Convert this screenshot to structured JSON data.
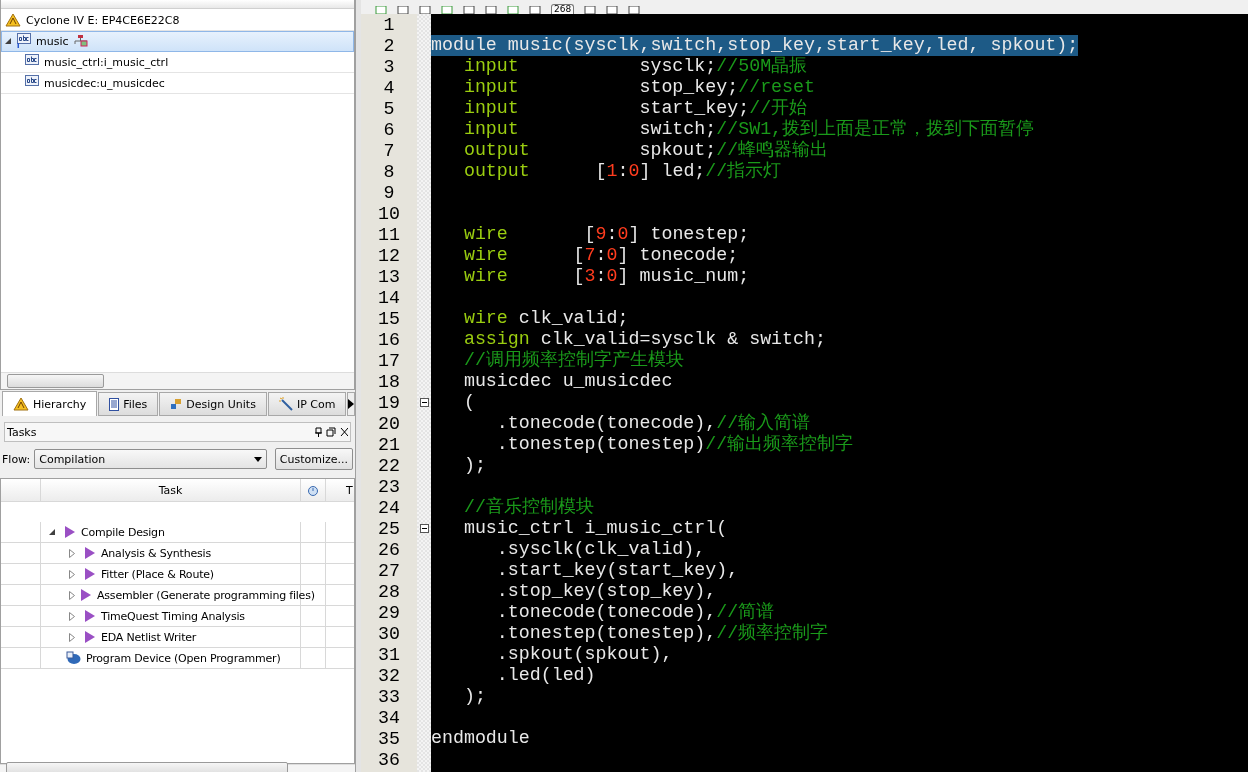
{
  "hierarchy": {
    "tree": [
      {
        "label": "Cyclone IV E: EP4CE6E22C8",
        "kind": "device",
        "selected": false
      },
      {
        "label": "music",
        "kind": "entity",
        "selected": true,
        "expanded": true,
        "children": [
          {
            "label": "music_ctrl:i_music_ctrl",
            "kind": "instance",
            "selected": false
          },
          {
            "label": "musicdec:u_musicdec",
            "kind": "instance",
            "selected": false
          }
        ]
      }
    ]
  },
  "tabs": [
    {
      "label": "Hierarchy",
      "kind": "hierarchy",
      "selected": true
    },
    {
      "label": "Files",
      "kind": "files",
      "selected": false
    },
    {
      "label": "Design Units",
      "kind": "units",
      "selected": false
    },
    {
      "label": "IP Com",
      "kind": "ip",
      "selected": false
    }
  ],
  "tasks": {
    "title": "Tasks",
    "flow_label": "Flow:",
    "flow_value": "Compilation",
    "customize": "Customize...",
    "columns": [
      "Task",
      "T"
    ],
    "rows": [
      {
        "label": "Compile Design",
        "kind": "compile",
        "expanded": true,
        "children": [
          {
            "label": "Analysis & Synthesis",
            "kind": "compile",
            "expanded": false
          },
          {
            "label": "Fitter (Place & Route)",
            "kind": "compile",
            "expanded": false
          },
          {
            "label": "Assembler (Generate programming files)",
            "kind": "compile",
            "expanded": false
          },
          {
            "label": "TimeQuest Timing Analysis",
            "kind": "compile",
            "expanded": false
          },
          {
            "label": "EDA Netlist Writer",
            "kind": "compile",
            "expanded": false
          }
        ]
      },
      {
        "label": "Program Device (Open Programmer)",
        "kind": "program"
      }
    ]
  },
  "toolbar": {
    "counter": "268"
  },
  "editor": {
    "lines": [
      {
        "number": "1"
      },
      {
        "number": "2",
        "selected": true,
        "segments": [
          {
            "kind": "text",
            "text": "module music(sysclk,switch,stop_key,start_key,led, spkout);"
          }
        ]
      },
      {
        "number": "3",
        "selected": false,
        "segments": [
          {
            "kind": "kw",
            "text": "   input"
          },
          {
            "kind": "text",
            "text": "           sysclk;"
          },
          {
            "kind": "comment",
            "text": "//50M晶振"
          }
        ]
      },
      {
        "number": "4",
        "selected": false,
        "segments": [
          {
            "kind": "kw",
            "text": "   input"
          },
          {
            "kind": "text",
            "text": "           stop_key;"
          },
          {
            "kind": "comment",
            "text": "//reset"
          }
        ]
      },
      {
        "number": "5",
        "selected": false,
        "segments": [
          {
            "kind": "kw",
            "text": "   input"
          },
          {
            "kind": "text",
            "text": "           start_key;"
          },
          {
            "kind": "comment",
            "text": "//开始"
          }
        ]
      },
      {
        "number": "6",
        "selected": false,
        "segments": [
          {
            "kind": "kw",
            "text": "   input"
          },
          {
            "kind": "text",
            "text": "           switch;"
          },
          {
            "kind": "comment",
            "text": "//SW1,拨到上面是正常，拨到下面暂停"
          }
        ]
      },
      {
        "number": "7",
        "selected": false,
        "segments": [
          {
            "kind": "kw",
            "text": "   output"
          },
          {
            "kind": "text",
            "text": "          spkout;"
          },
          {
            "kind": "comment",
            "text": "//蜂鸣器输出"
          }
        ]
      },
      {
        "number": "8",
        "selected": false,
        "segments": [
          {
            "kind": "kw",
            "text": "   output"
          },
          {
            "kind": "text",
            "text": "      ["
          },
          {
            "kind": "num",
            "text": "1"
          },
          {
            "kind": "text",
            "text": ":"
          },
          {
            "kind": "num",
            "text": "0"
          },
          {
            "kind": "text",
            "text": "] led;"
          },
          {
            "kind": "comment",
            "text": "//指示灯"
          }
        ]
      },
      {
        "number": "9"
      },
      {
        "number": "10"
      },
      {
        "number": "11",
        "selected": false,
        "segments": [
          {
            "kind": "kw",
            "text": "   wire"
          },
          {
            "kind": "text",
            "text": "       ["
          },
          {
            "kind": "num",
            "text": "9"
          },
          {
            "kind": "text",
            "text": ":"
          },
          {
            "kind": "num",
            "text": "0"
          },
          {
            "kind": "text",
            "text": "] tonestep;"
          }
        ]
      },
      {
        "number": "12",
        "selected": false,
        "segments": [
          {
            "kind": "kw",
            "text": "   wire"
          },
          {
            "kind": "text",
            "text": "      ["
          },
          {
            "kind": "num",
            "text": "7"
          },
          {
            "kind": "text",
            "text": ":"
          },
          {
            "kind": "num",
            "text": "0"
          },
          {
            "kind": "text",
            "text": "] tonecode;"
          }
        ]
      },
      {
        "number": "13",
        "selected": false,
        "segments": [
          {
            "kind": "kw",
            "text": "   wire"
          },
          {
            "kind": "text",
            "text": "      ["
          },
          {
            "kind": "num",
            "text": "3"
          },
          {
            "kind": "text",
            "text": ":"
          },
          {
            "kind": "num",
            "text": "0"
          },
          {
            "kind": "text",
            "text": "] music_num;"
          }
        ]
      },
      {
        "number": "14"
      },
      {
        "number": "15",
        "selected": false,
        "segments": [
          {
            "kind": "kw",
            "text": "   wire"
          },
          {
            "kind": "text",
            "text": " clk_valid;"
          }
        ]
      },
      {
        "number": "16",
        "selected": false,
        "segments": [
          {
            "kind": "kw",
            "text": "   assign"
          },
          {
            "kind": "text",
            "text": " clk_valid=sysclk & switch;"
          }
        ]
      },
      {
        "number": "17",
        "selected": false,
        "segments": [
          {
            "kind": "comment",
            "text": "   //调用频率控制字产生模块"
          }
        ]
      },
      {
        "number": "18",
        "selected": false,
        "segments": [
          {
            "kind": "text",
            "text": "   musicdec u_musicdec"
          }
        ]
      },
      {
        "number": "19",
        "selected": false,
        "fold": true,
        "segments": [
          {
            "kind": "text",
            "text": "   ("
          }
        ]
      },
      {
        "number": "20",
        "selected": false,
        "segments": [
          {
            "kind": "text",
            "text": "      .tonecode(tonecode),"
          },
          {
            "kind": "comment",
            "text": "//输入简谱"
          }
        ]
      },
      {
        "number": "21",
        "selected": false,
        "segments": [
          {
            "kind": "text",
            "text": "      .tonestep(tonestep)"
          },
          {
            "kind": "comment",
            "text": "//输出频率控制字"
          }
        ]
      },
      {
        "number": "22",
        "selected": false,
        "segments": [
          {
            "kind": "text",
            "text": "   );"
          }
        ]
      },
      {
        "number": "23"
      },
      {
        "number": "24",
        "selected": false,
        "segments": [
          {
            "kind": "comment",
            "text": "   //音乐控制模块"
          }
        ]
      },
      {
        "number": "25",
        "selected": false,
        "fold": true,
        "segments": [
          {
            "kind": "text",
            "text": "   music_ctrl i_music_ctrl("
          }
        ]
      },
      {
        "number": "26",
        "selected": false,
        "segments": [
          {
            "kind": "text",
            "text": "      .sysclk(clk_valid),"
          }
        ]
      },
      {
        "number": "27",
        "selected": false,
        "segments": [
          {
            "kind": "text",
            "text": "      .start_key(start_key),"
          }
        ]
      },
      {
        "number": "28",
        "selected": false,
        "segments": [
          {
            "kind": "text",
            "text": "      .stop_key(stop_key),"
          }
        ]
      },
      {
        "number": "29",
        "selected": false,
        "segments": [
          {
            "kind": "text",
            "text": "      .tonecode(tonecode),"
          },
          {
            "kind": "comment",
            "text": "//简谱"
          }
        ]
      },
      {
        "number": "30",
        "selected": false,
        "segments": [
          {
            "kind": "text",
            "text": "      .tonestep(tonestep),"
          },
          {
            "kind": "comment",
            "text": "//频率控制字"
          }
        ]
      },
      {
        "number": "31",
        "selected": false,
        "segments": [
          {
            "kind": "text",
            "text": "      .spkout(spkout),"
          }
        ]
      },
      {
        "number": "32",
        "selected": false,
        "segments": [
          {
            "kind": "text",
            "text": "      .led(led)"
          }
        ]
      },
      {
        "number": "33",
        "selected": false,
        "segments": [
          {
            "kind": "text",
            "text": "   );"
          }
        ]
      },
      {
        "number": "34"
      },
      {
        "number": "35",
        "selected": false,
        "segments": [
          {
            "kind": "text",
            "text": "endmodule"
          }
        ]
      },
      {
        "number": "36"
      }
    ]
  }
}
